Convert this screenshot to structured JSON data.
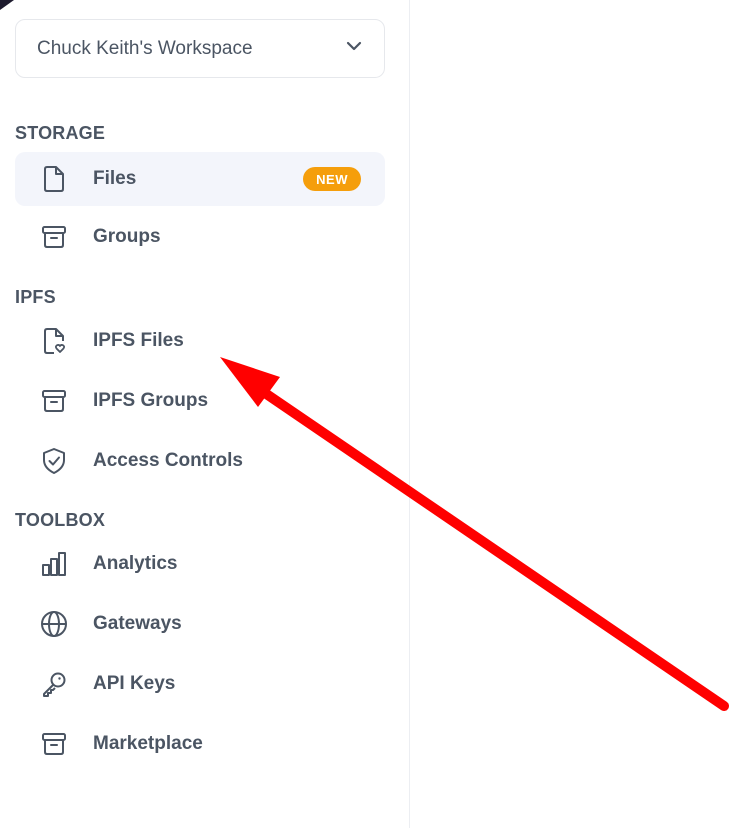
{
  "workspace": {
    "name": "Chuck Keith's Workspace",
    "icon": "chevron-down-icon"
  },
  "sections": {
    "storage": {
      "label": "STORAGE",
      "items": [
        {
          "label": "Files",
          "icon": "file-icon",
          "badge": "NEW",
          "active": true
        },
        {
          "label": "Groups",
          "icon": "archive-icon"
        }
      ]
    },
    "ipfs": {
      "label": "IPFS",
      "items": [
        {
          "label": "IPFS Files",
          "icon": "file-heart-icon"
        },
        {
          "label": "IPFS Groups",
          "icon": "archive-icon"
        },
        {
          "label": "Access Controls",
          "icon": "shield-check-icon"
        }
      ]
    },
    "toolbox": {
      "label": "TOOLBOX",
      "items": [
        {
          "label": "Analytics",
          "icon": "bar-chart-icon"
        },
        {
          "label": "Gateways",
          "icon": "globe-icon"
        },
        {
          "label": "API Keys",
          "icon": "key-icon"
        },
        {
          "label": "Marketplace",
          "icon": "archive-icon"
        }
      ]
    }
  },
  "annotation": {
    "type": "arrow",
    "color": "#ff0000",
    "points_to": "IPFS Files"
  },
  "colors": {
    "text": "#4b5563",
    "active_bg": "#f3f5fb",
    "badge": "#f59e0b",
    "border": "#e6e8ec"
  }
}
